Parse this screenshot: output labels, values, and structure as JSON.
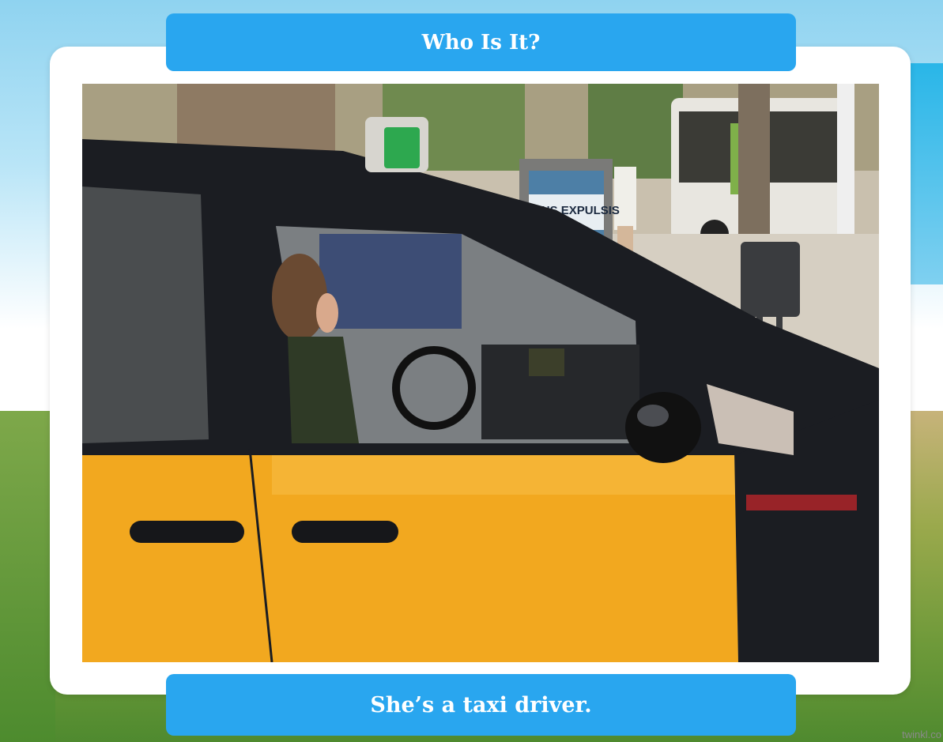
{
  "slide": {
    "title": "Who Is It?",
    "caption": "She’s a taxi driver.",
    "watermark": "twinkl.co"
  },
  "photo": {
    "sign_text": "NO ENS EXPULSIS"
  },
  "colors": {
    "banner": "#29a6ef",
    "taxi_yellow": "#f2a81f",
    "taxi_black": "#1b1d22"
  }
}
